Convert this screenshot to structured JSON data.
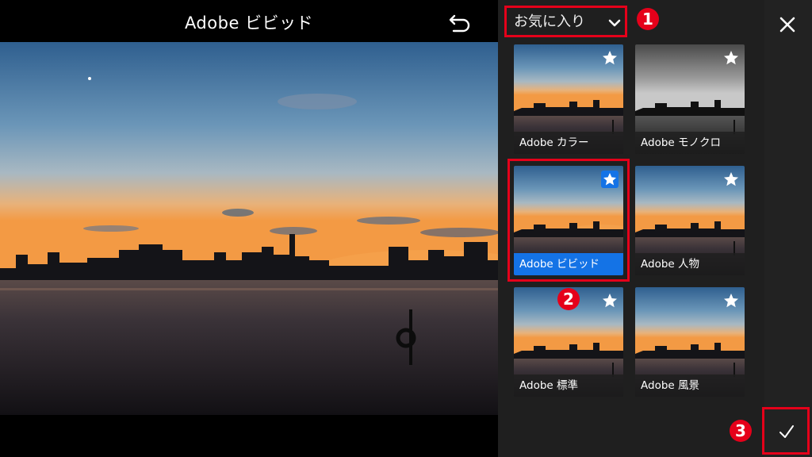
{
  "header": {
    "title": "Adobe ビビッド"
  },
  "panel": {
    "filter_label": "お気に入り",
    "presets": [
      {
        "label": "Adobe カラー",
        "favorite": false,
        "selected": false
      },
      {
        "label": "Adobe モノクロ",
        "favorite": false,
        "selected": false
      },
      {
        "label": "Adobe ビビッド",
        "favorite": true,
        "selected": true
      },
      {
        "label": "Adobe 人物",
        "favorite": false,
        "selected": false
      },
      {
        "label": "Adobe 標準",
        "favorite": false,
        "selected": false
      },
      {
        "label": "Adobe 風景",
        "favorite": false,
        "selected": false
      }
    ]
  },
  "annotations": {
    "step1": "1",
    "step2": "2",
    "step3": "3"
  },
  "colors": {
    "highlight": "#e5001a",
    "selected": "#1473e6",
    "panel_bg": "#1f1f1f"
  },
  "icons": {
    "undo": "undo-icon",
    "close": "close-icon",
    "confirm": "checkmark-icon",
    "dropdown": "chevron-down-icon",
    "favorite": "star-icon"
  }
}
